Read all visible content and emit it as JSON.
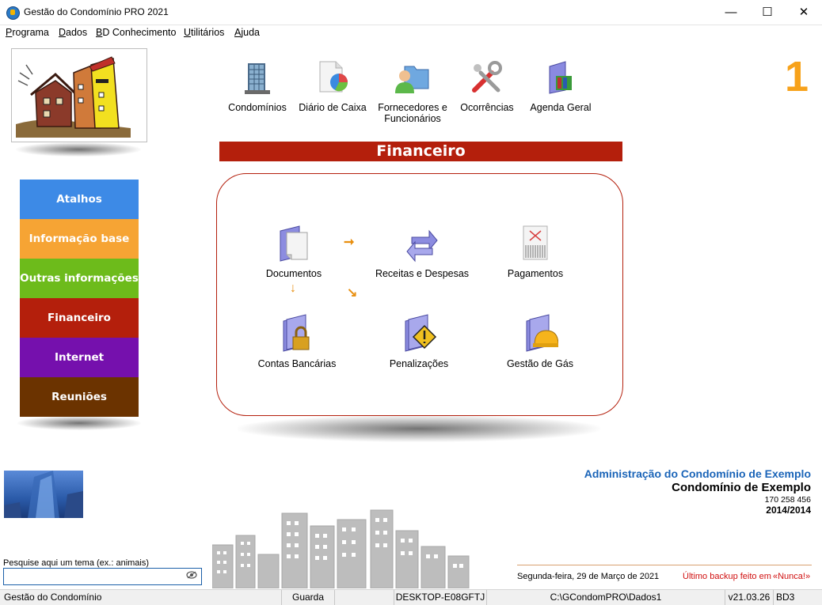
{
  "window": {
    "title": "Gestão do Condomínio PRO 2021",
    "minimize": "—",
    "maximize": "☐",
    "close": "✕"
  },
  "menu": [
    {
      "first": "P",
      "rest": "rograma"
    },
    {
      "first": "D",
      "rest": "ados"
    },
    {
      "first": "B",
      "rest": "D Conhecimento"
    },
    {
      "first": "U",
      "rest": "tilitários"
    },
    {
      "first": "A",
      "rest": "juda"
    }
  ],
  "toolbar": {
    "condominios": "Condomínios",
    "diario": "Diário de Caixa",
    "fornecedores_l1": "Fornecedores e",
    "fornecedores_l2": "Funcionários",
    "ocorrencias": "Ocorrências",
    "agenda": "Agenda Geral"
  },
  "badge": "1",
  "nav": [
    {
      "label": "Atalhos",
      "color": "#3d8ae6"
    },
    {
      "label": "Informação base",
      "color": "#f6a434"
    },
    {
      "label": "Outras informações",
      "color": "#6dbb1b"
    },
    {
      "label": "Financeiro",
      "color": "#b41f0c"
    },
    {
      "label": "Internet",
      "color": "#7510ad"
    },
    {
      "label": "Reuniões",
      "color": "#6b3300"
    }
  ],
  "section": {
    "title": "Financeiro",
    "items": {
      "documentos": "Documentos",
      "receitas": "Receitas e Despesas",
      "pagamentos": "Pagamentos",
      "contas": "Contas Bancárias",
      "penalizacoes": "Penalizações",
      "gas": "Gestão de Gás"
    }
  },
  "info": {
    "admin": "Administração do Condomínio de Exemplo",
    "condominio": "Condomínio de Exemplo",
    "numero": "170 258 456",
    "periodo": "2014/2014"
  },
  "footer": {
    "date": "Segunda-feira, 29 de Março de 2021",
    "backup_label": "Último backup feito em",
    "backup_value": "«Nunca!»"
  },
  "search": {
    "label": "Pesquise aqui um tema (ex.: animais)",
    "value": ""
  },
  "status": {
    "app": "Gestão do Condomínio",
    "user": "Guarda",
    "computer": "DESKTOP-E08GFTJ",
    "path": "C:\\GCondomPRO\\Dados1",
    "version": "v21.03.26",
    "db": "BD3"
  },
  "colors": {
    "accent": "#b41f0c",
    "badge": "#f7a21b",
    "admin_text": "#1a64b8",
    "backup_text": "#d01010"
  }
}
